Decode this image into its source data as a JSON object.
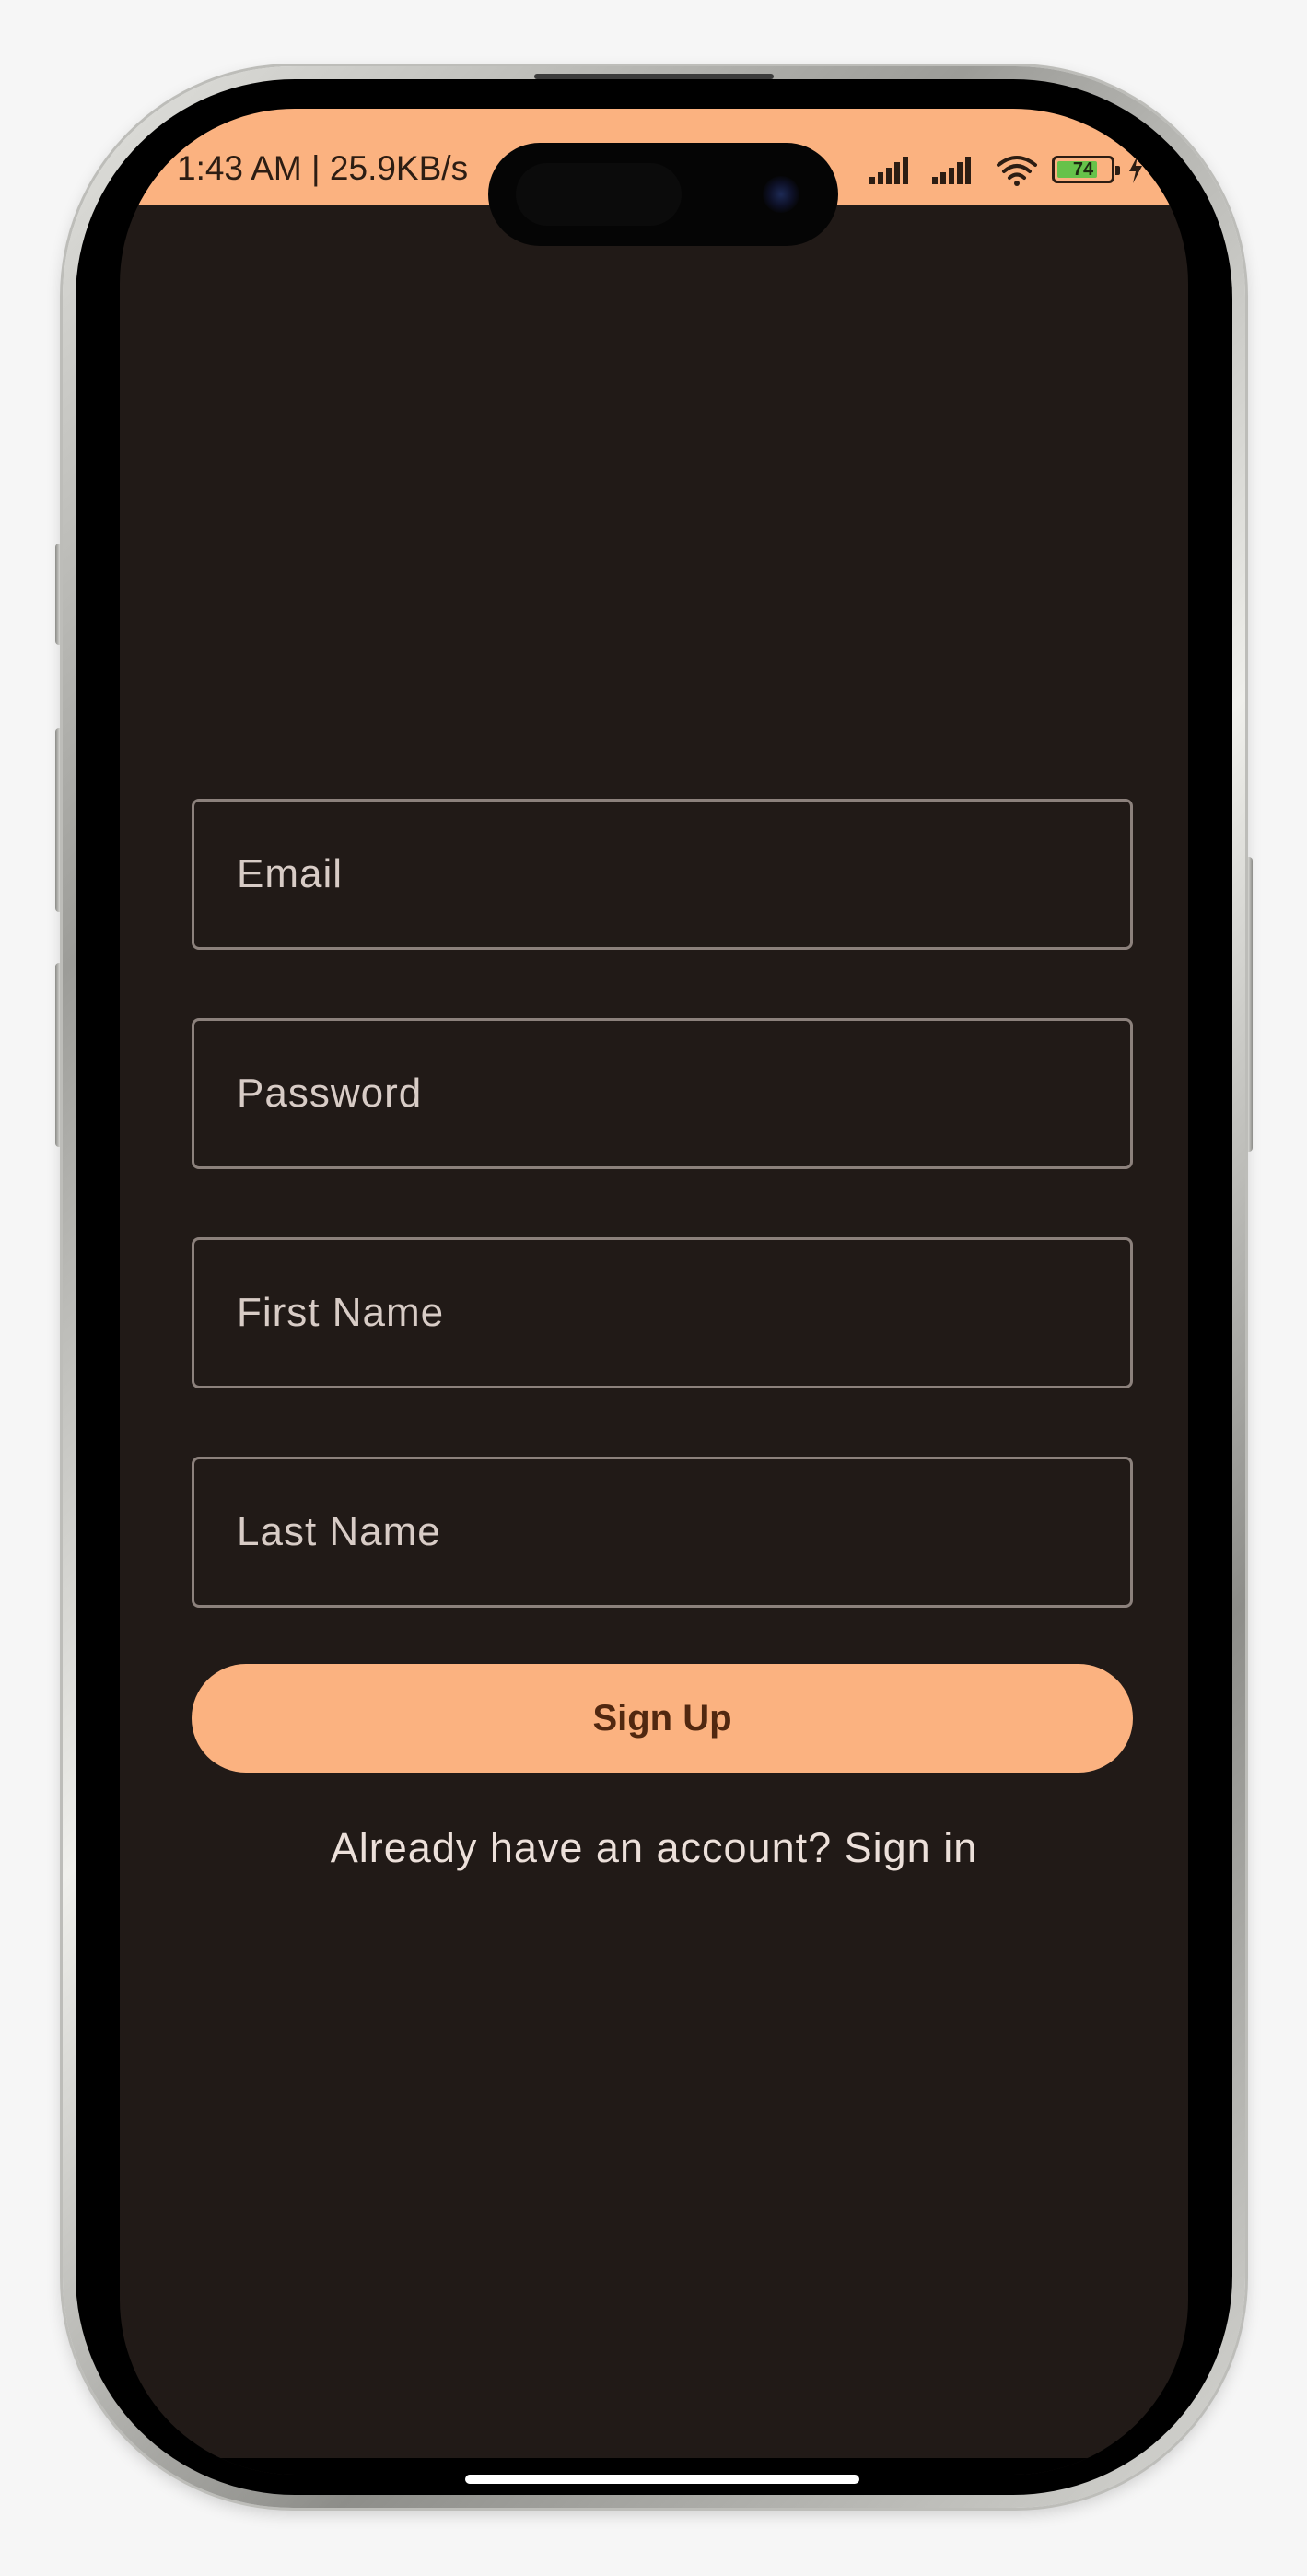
{
  "status_bar": {
    "text": "1:43 AM | 25.9KB/s",
    "battery_level": "74",
    "icons": [
      "signal-icon",
      "signal-icon",
      "wifi-icon",
      "battery-icon",
      "charging-icon"
    ]
  },
  "form": {
    "email_placeholder": "Email",
    "password_placeholder": "Password",
    "first_name_placeholder": "First Name",
    "last_name_placeholder": "Last Name",
    "email_value": "",
    "password_value": "",
    "first_name_value": "",
    "last_name_value": ""
  },
  "actions": {
    "signup_label": "Sign Up",
    "signin_link": "Already have an account? Sign in"
  },
  "colors": {
    "accent": "#fbb280",
    "background": "#211a17",
    "field_border": "#8c817c",
    "text": "#ece0da",
    "button_text": "#512810"
  }
}
